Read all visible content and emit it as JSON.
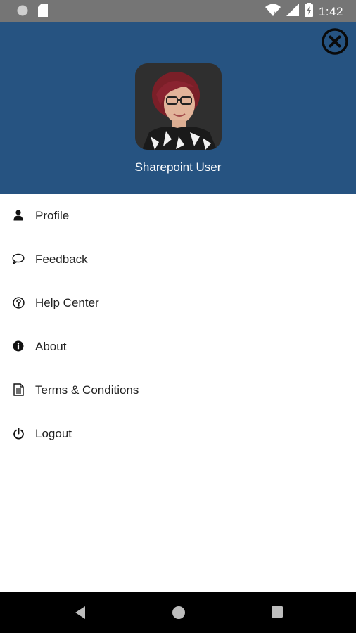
{
  "status_bar": {
    "time": "1:42",
    "icons": [
      "circle-icon",
      "sd-card-icon",
      "wifi-icon",
      "signal-icon",
      "battery-icon"
    ]
  },
  "drawer": {
    "user_name": "Sharepoint User",
    "header_color": "#265381",
    "close_icon": "close-circle-icon"
  },
  "menu": {
    "items": [
      {
        "label": "Profile",
        "icon": "person-icon"
      },
      {
        "label": "Feedback",
        "icon": "chat-bubble-icon"
      },
      {
        "label": "Help Center",
        "icon": "help-circle-icon"
      },
      {
        "label": "About",
        "icon": "info-icon"
      },
      {
        "label": "Terms & Conditions",
        "icon": "document-icon"
      },
      {
        "label": "Logout",
        "icon": "power-icon"
      }
    ]
  },
  "nav_bar": {
    "buttons": [
      "back-icon",
      "home-icon",
      "recents-icon"
    ]
  }
}
